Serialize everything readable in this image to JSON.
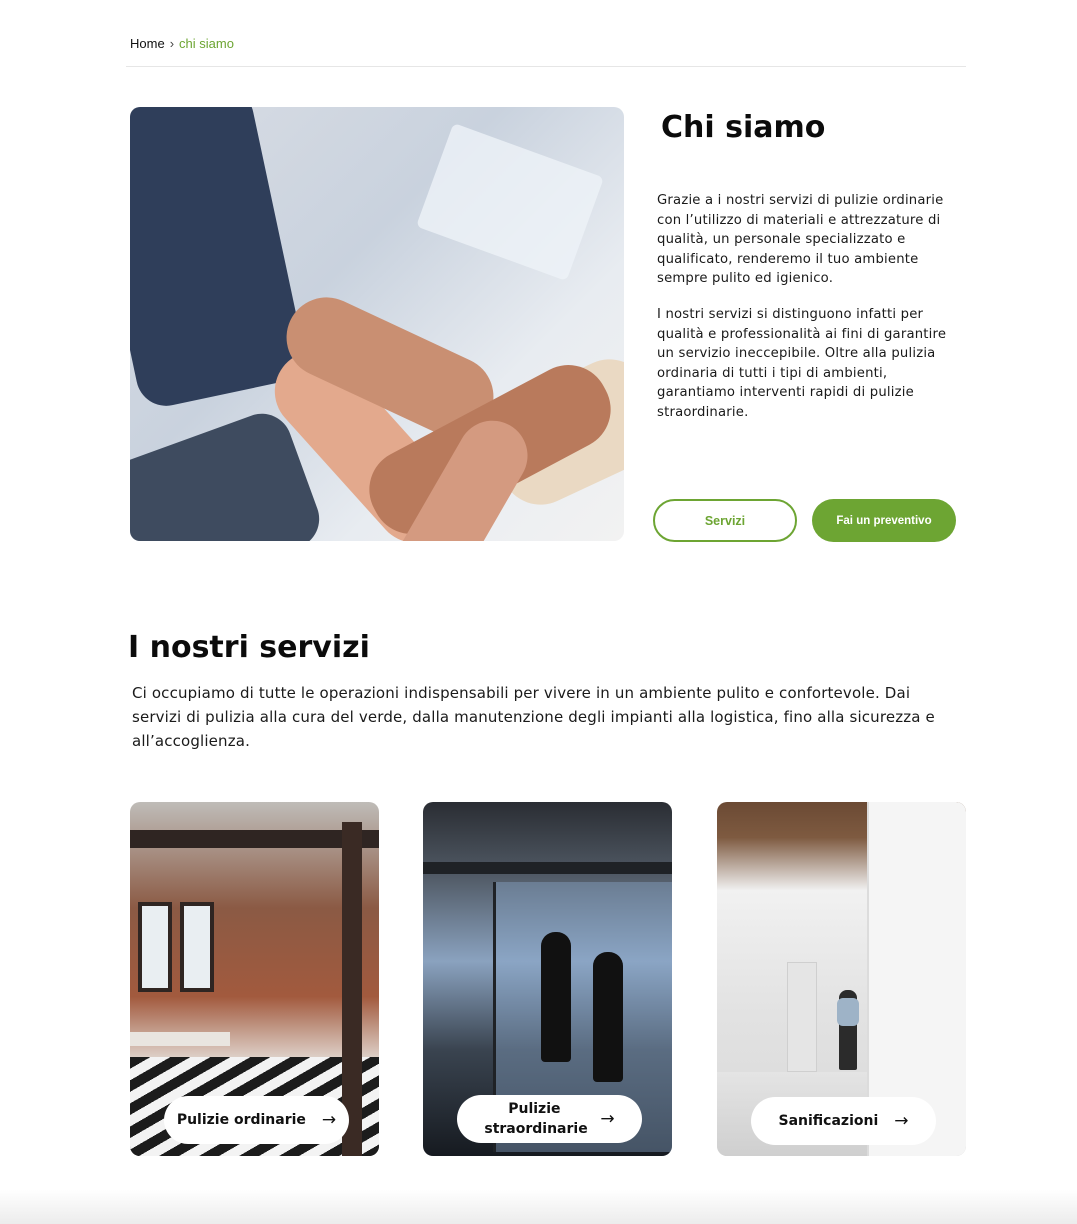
{
  "breadcrumb": {
    "home": "Home",
    "separator": "›",
    "current": "chi siamo"
  },
  "about": {
    "title": "Chi siamo",
    "paragraph1": "Grazie a i nostri servizi di pulizie ordinarie con l’utilizzo di materiali e attrezzature di qualità, un personale specializzato e qualificato, renderemo il tuo ambiente sempre pulito ed igienico.",
    "paragraph2": "I nostri servizi si distinguono infatti per qualità e professionalità ai fini di garantire un servizio ineccepibile. Oltre alla pulizia ordinaria di tutti i tipi di ambienti, garantiamo interventi rapidi di pulizie straordinarie.",
    "button_services": "Servizi",
    "button_quote": "Fai un preventivo"
  },
  "services": {
    "title": "I nostri servizi",
    "description": "Ci occupiamo di tutte le operazioni indispensabili per vivere in un ambiente pulito e confortevole. Dai servizi di pulizia alla cura del verde, dalla manutenzione degli impianti alla logistica, fino alla sicurezza e all’accoglienza.",
    "cards": [
      {
        "label": "Pulizie ordinarie",
        "arrow": "→"
      },
      {
        "label": "Pulizie straordinarie",
        "arrow": "→"
      },
      {
        "label": "Sanificazioni",
        "arrow": "→"
      }
    ]
  },
  "colors": {
    "accent": "#6da533",
    "text": "#111111",
    "divider": "#e6e6e6"
  }
}
